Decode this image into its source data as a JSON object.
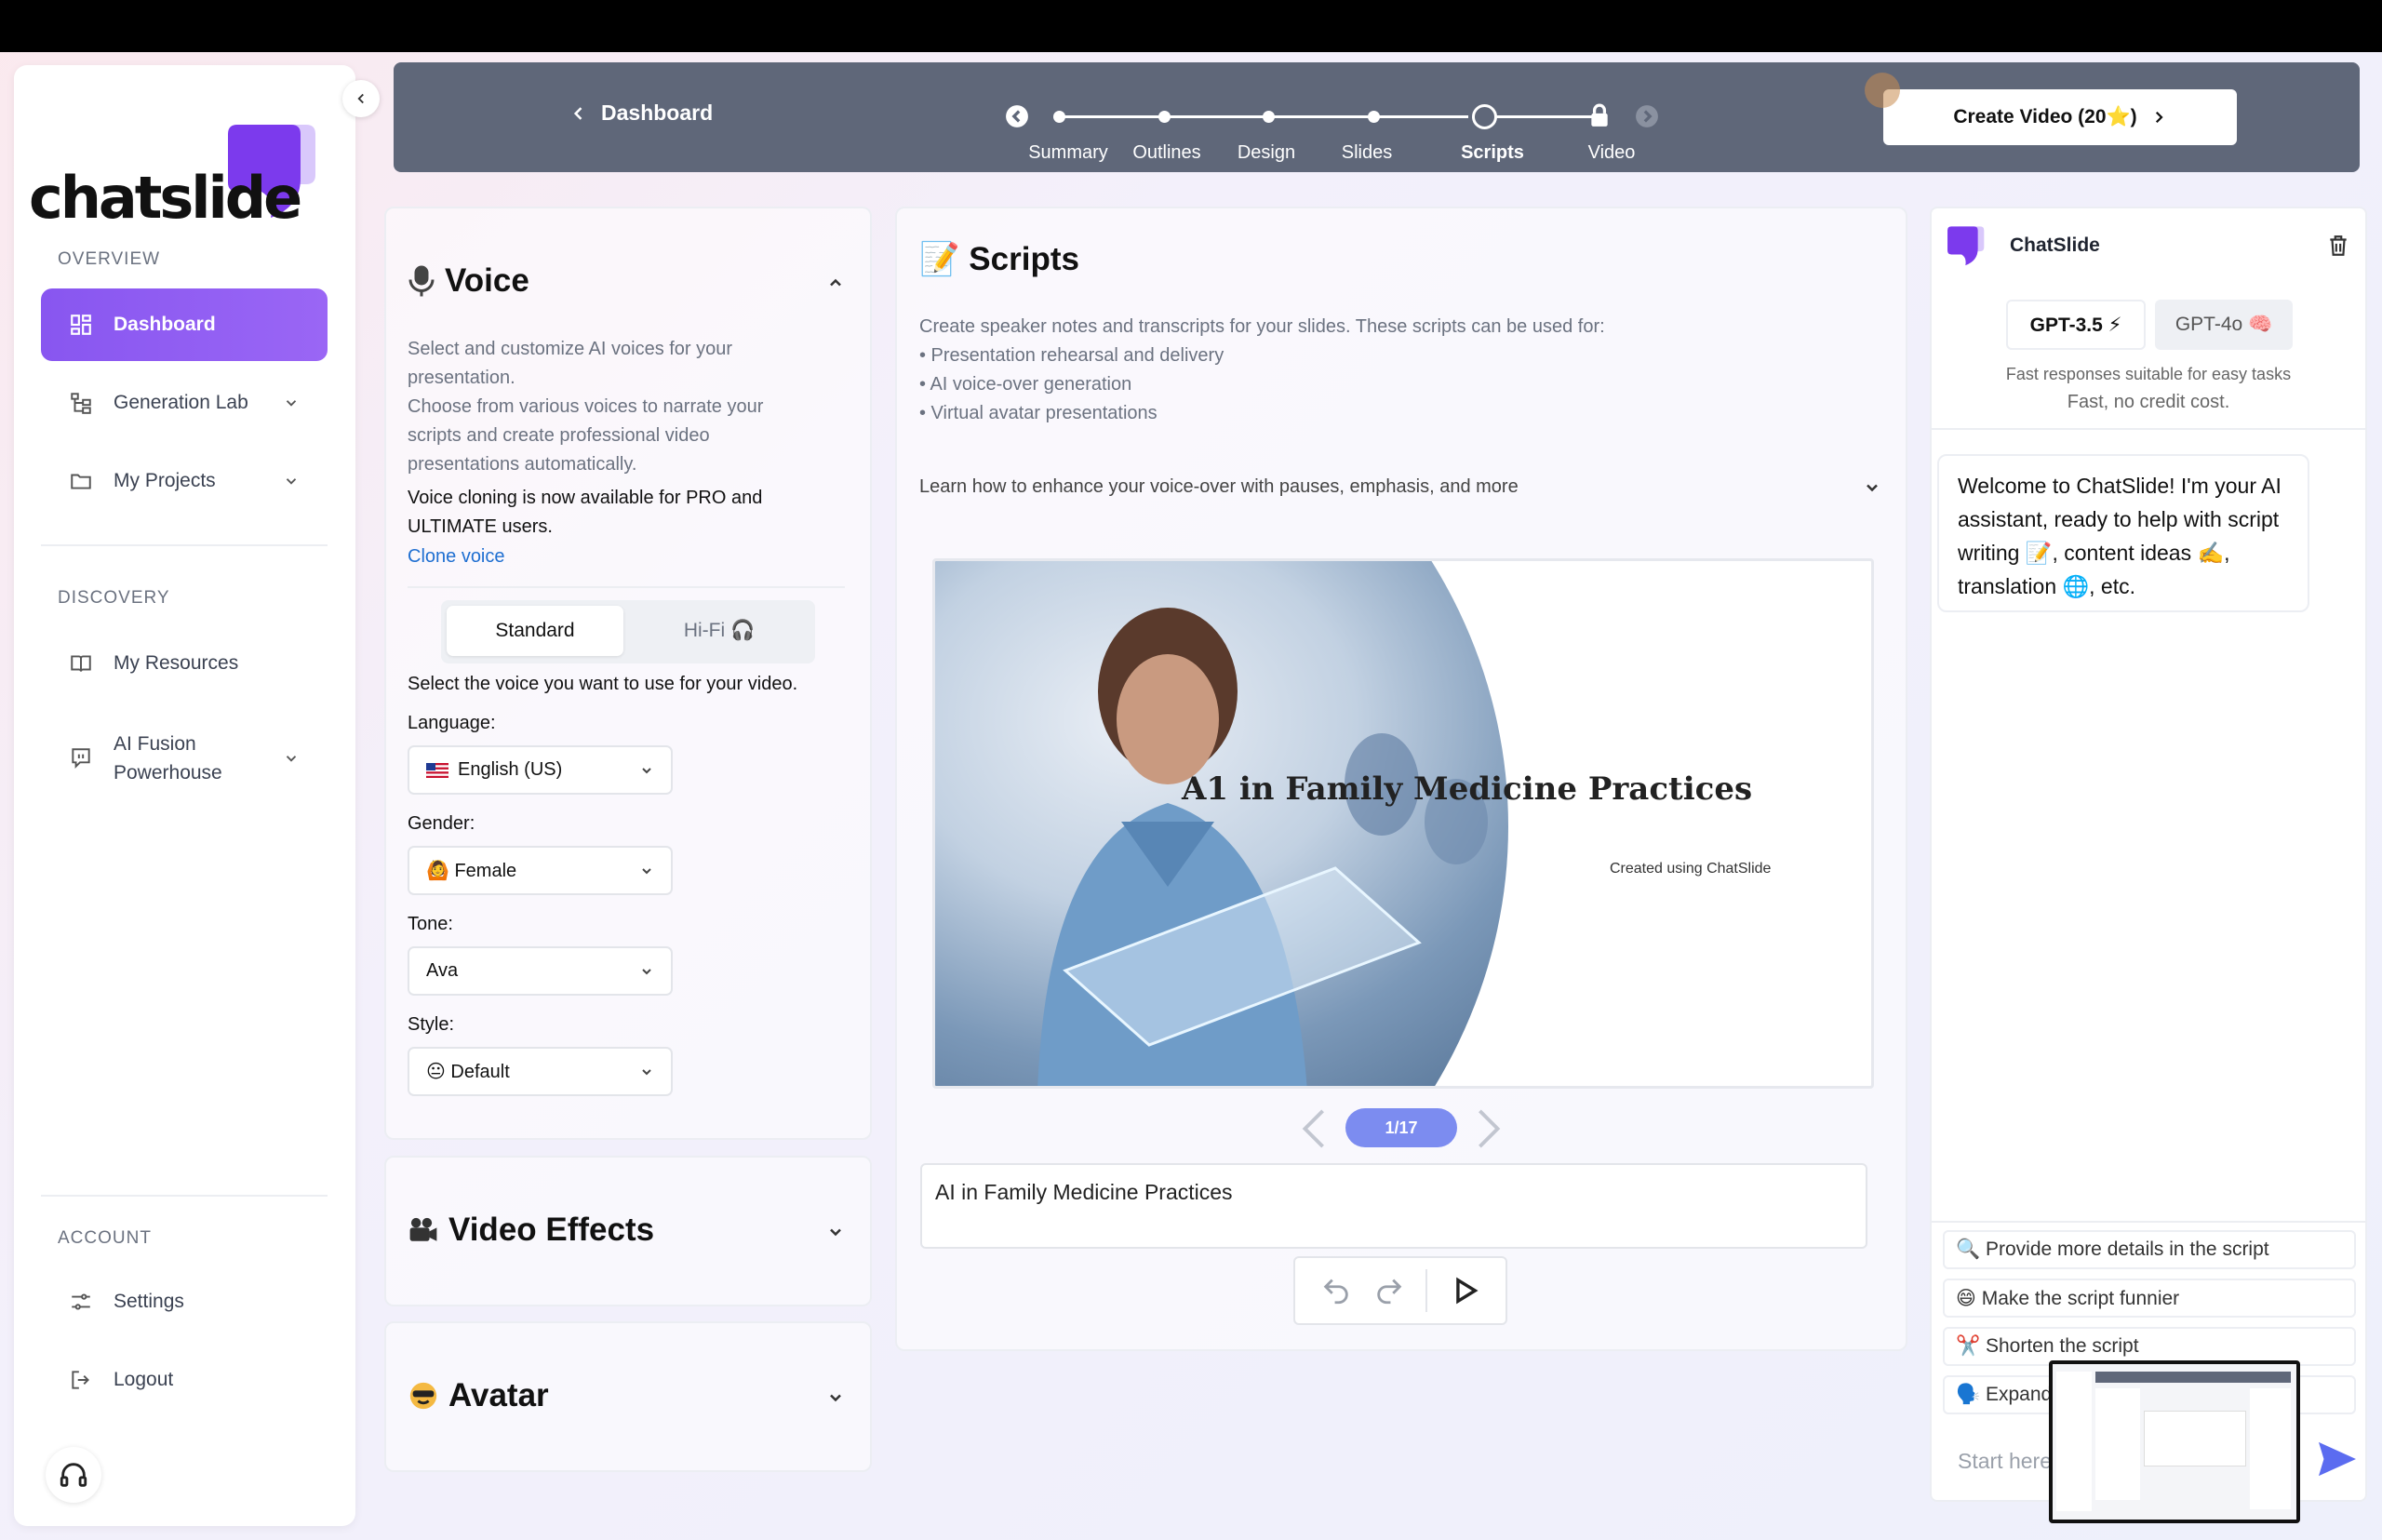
{
  "brand": {
    "logo_text": "chatslide"
  },
  "sidebar": {
    "overview_label": "OVERVIEW",
    "discovery_label": "DISCOVERY",
    "account_label": "ACCOUNT",
    "items": [
      {
        "label": "Dashboard"
      },
      {
        "label": "Generation Lab"
      },
      {
        "label": "My Projects"
      },
      {
        "label": "My Resources"
      },
      {
        "label": "AI Fusion Powerhouse"
      },
      {
        "label": "Settings"
      },
      {
        "label": "Logout"
      }
    ]
  },
  "header": {
    "back_label": "Dashboard",
    "steps": [
      "Summary",
      "Outlines",
      "Design",
      "Slides",
      "Scripts",
      "Video"
    ],
    "current_step": "Scripts",
    "create_label": "Create Video (20⭐)"
  },
  "voice": {
    "title": "Voice",
    "desc1": "Select and customize AI voices for your presentation.",
    "desc2": "Choose from various voices to narrate your scripts and create professional video presentations automatically.",
    "desc3": "Voice cloning is now available for PRO and ULTIMATE users.",
    "clone_link": "Clone voice",
    "tab_standard": "Standard",
    "tab_hifi": "Hi-Fi 🎧",
    "select_prompt": "Select the voice you want to use for your video.",
    "language_label": "Language:",
    "language_value": "English (US)",
    "gender_label": "Gender:",
    "gender_value": "🙆 Female",
    "tone_label": "Tone:",
    "tone_value": "Ava",
    "style_label": "Style:",
    "style_value": "😐 Default"
  },
  "video_effects": {
    "title": "Video Effects"
  },
  "avatar": {
    "title": "Avatar"
  },
  "scripts": {
    "title": "📝 Scripts",
    "intro": "Create speaker notes and transcripts for your slides. These scripts can be used for:",
    "bullets": [
      "• Presentation rehearsal and delivery",
      "• AI voice-over generation",
      "• Virtual avatar presentations"
    ],
    "learn_more": "Learn how to enhance your voice-over with pauses, emphasis, and more",
    "slide_title": "A1 in Family Medicine Practices",
    "slide_credit": "Created using ChatSlide",
    "pager": "1/17",
    "script_text": "AI in Family Medicine Practices"
  },
  "chat": {
    "name": "ChatSlide",
    "model_a": "GPT-3.5 ⚡",
    "model_b": "GPT-4o 🧠",
    "model_desc1": "Fast responses suitable for easy tasks",
    "model_desc2": "Fast, no credit cost.",
    "welcome": "Welcome to ChatSlide! I'm your AI assistant, ready to help with script writing 📝, content ideas ✍️, translation 🌐, etc.",
    "suggestions": [
      "🔍 Provide more details in the script",
      "😄 Make the script funnier",
      "✂️ Shorten the script",
      "🗣️ Expand"
    ],
    "input_placeholder": "Start here"
  },
  "colors": {
    "accent": "#8b5cf6",
    "header_bg": "#5f6779",
    "pager": "#7c8cf0",
    "link": "#1f6fd1"
  }
}
